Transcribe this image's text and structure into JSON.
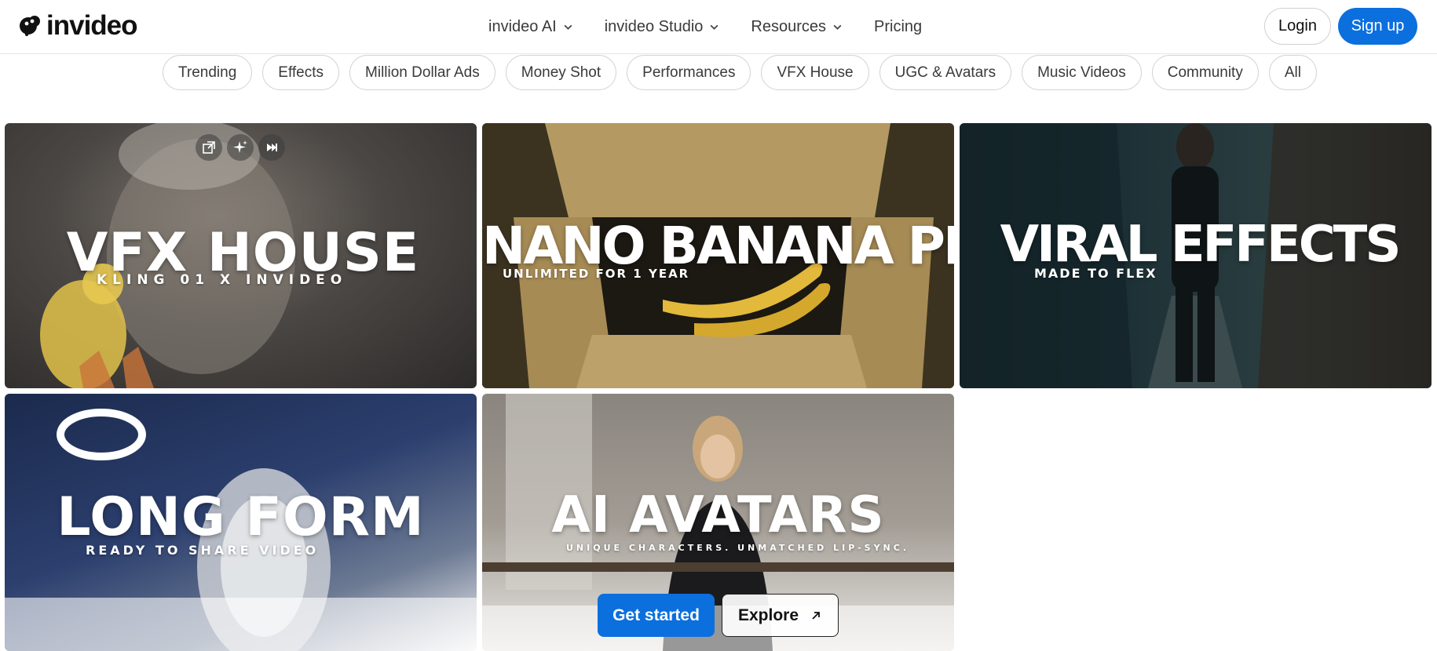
{
  "header": {
    "brand": "invideo",
    "nav": [
      {
        "label": "invideo AI",
        "has_menu": true
      },
      {
        "label": "invideo Studio",
        "has_menu": true
      },
      {
        "label": "Resources",
        "has_menu": true
      },
      {
        "label": "Pricing",
        "has_menu": false
      }
    ],
    "login_label": "Login",
    "signup_label": "Sign up"
  },
  "categories": [
    "Trending",
    "Effects",
    "Million Dollar Ads",
    "Money Shot",
    "Performances",
    "VFX House",
    "UGC & Avatars",
    "Music Videos",
    "Community",
    "All"
  ],
  "cards": [
    {
      "title": "VFX HOUSE",
      "subtitle": "KLING 01 X INVIDEO"
    },
    {
      "title": "NANO BANANA PRO",
      "subtitle": "UNLIMITED FOR 1 YEAR"
    },
    {
      "title": "VIRAL EFFECTS",
      "subtitle": "MADE TO FLEX"
    },
    {
      "title": "LONG FORM",
      "subtitle": "READY TO SHARE VIDEO"
    },
    {
      "title": "AI AVATARS",
      "subtitle": "UNIQUE CHARACTERS. UNMATCHED LIP-SYNC."
    }
  ],
  "cta": {
    "primary_label": "Get started",
    "secondary_label": "Explore"
  },
  "colors": {
    "accent": "#0b6fde",
    "pill_border": "#d4d4d4"
  },
  "icons": [
    "invideo-logo-icon",
    "chevron-down-icon",
    "open-external-icon",
    "sparkles-icon",
    "skip-forward-icon",
    "arrow-up-right-icon"
  ]
}
